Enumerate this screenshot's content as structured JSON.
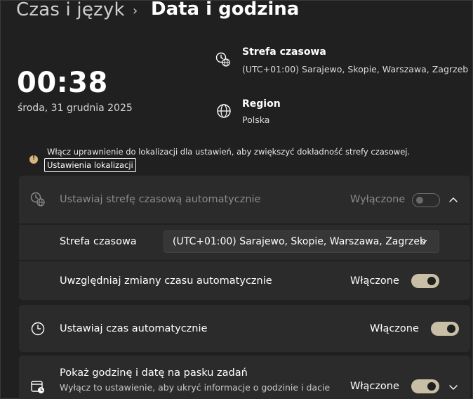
{
  "breadcrumb": {
    "parent": "Czas i język",
    "separator": "›",
    "current": "Data i godzina"
  },
  "clock": {
    "time": "00:38",
    "date": "środa, 31 grudnia 2025"
  },
  "timezone_info": {
    "icon": "timezone-globe-icon",
    "title": "Strefa czasowa",
    "value": "(UTC+01:00) Sarajewo, Skopie, Warszawa, Zagrzeb"
  },
  "region_info": {
    "icon": "globe-icon",
    "title": "Region",
    "value": "Polska"
  },
  "notice": {
    "icon": "warning-icon",
    "text": "Włącz uprawnienie do lokalizacji dla ustawień, aby zwiększyć dokładność strefy czasowej.",
    "link": "Ustawienia lokalizacji"
  },
  "auto_timezone": {
    "label": "Ustawiaj strefę czasową automatycznie",
    "state": "Wyłączone",
    "enabled": false
  },
  "timezone_select": {
    "label": "Strefa czasowa",
    "value": "(UTC+01:00) Sarajewo, Skopie, Warszawa, Zagrzeb"
  },
  "dst": {
    "label": "Uwzględniaj zmiany czasu automatycznie",
    "state": "Włączone",
    "enabled": true
  },
  "auto_time": {
    "label": "Ustawiaj czas automatycznie",
    "state": "Włączone",
    "enabled": true
  },
  "taskbar_clock": {
    "label": "Pokaż godzinę i datę na pasku zadań",
    "description": "Wyłącz to ustawienie, aby ukryć informacje o godzinie i dacie",
    "state": "Włączone",
    "enabled": true
  },
  "colors": {
    "background": "#202020",
    "card": "#2b2b2b",
    "toggle_on": "#c8bfa6"
  }
}
